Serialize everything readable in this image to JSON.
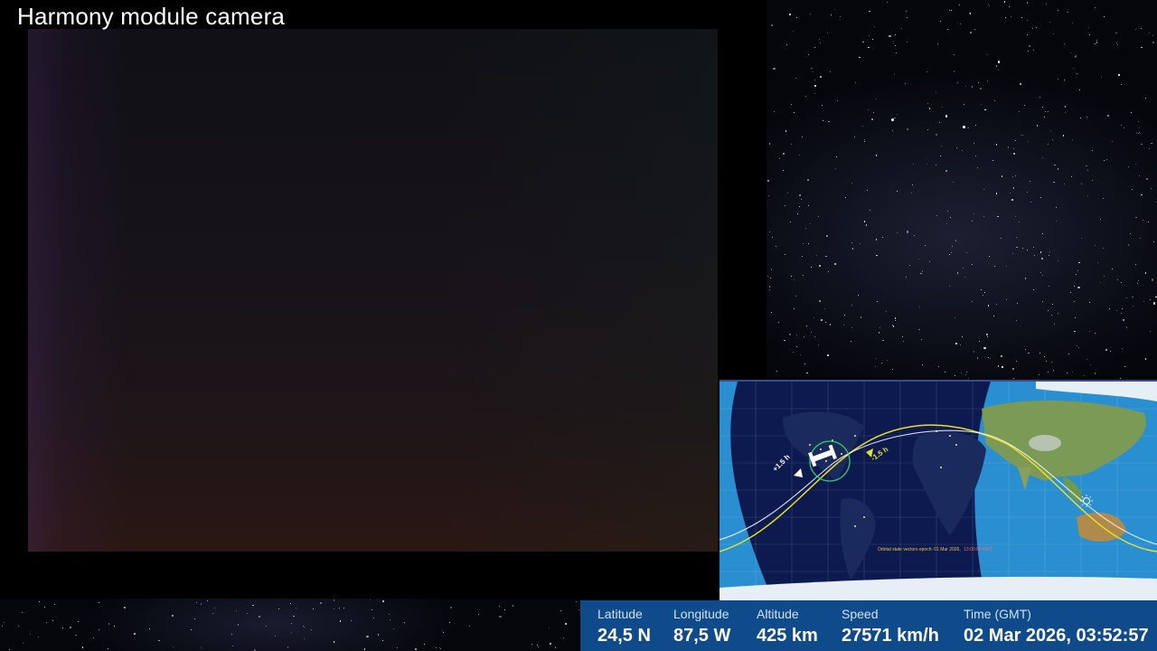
{
  "camera": {
    "title": "Harmony module camera"
  },
  "map": {
    "epoch_label": "Orbital state vectors epoch: 01 Mar 2026,",
    "epoch_time": "13:00:00 GMT",
    "plus_label": "+1.5 h",
    "minus_label": "-1.5 h"
  },
  "info": {
    "latitude_label": "Latitude",
    "latitude_value": "24,5 N",
    "longitude_label": "Longitude",
    "longitude_value": "87,5 W",
    "altitude_label": "Altitude",
    "altitude_value": "425 km",
    "speed_label": "Speed",
    "speed_value": "27571 km/h",
    "time_label": "Time (GMT)",
    "time_value": "02 Mar 2026, 03:52:57"
  },
  "colors": {
    "info_bar": "#0f4a8a",
    "orbit_future": "#e8e02a",
    "orbit_past": "#ffffff",
    "iss_footprint": "#2ecc71"
  },
  "icons": [
    "iss-icon",
    "sun-icon"
  ]
}
